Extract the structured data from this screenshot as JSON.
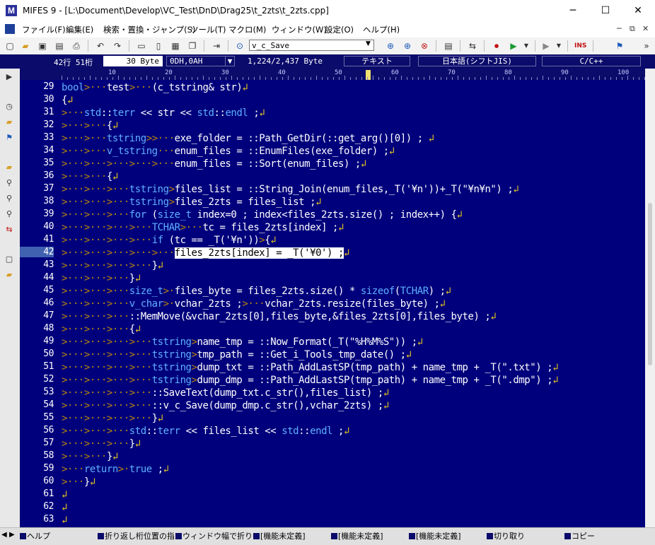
{
  "window": {
    "title": "MIFES 9 - [L:\\Document\\Develop\\VC_Test\\DnD\\Drag25\\t_2zts\\t_2zts.cpp]",
    "app_icon_letter": "M"
  },
  "menu": [
    "ファイル(F)",
    "編集(E)",
    "検索・置換・ジャンプ(S)",
    "ツール(T)",
    "マクロ(M)",
    "ウィンドウ(W)",
    "設定(O)",
    "ヘルプ(H)"
  ],
  "toolbar": {
    "search_value": "v_c_Save"
  },
  "status": {
    "position": "42行  51桁",
    "bytes": "30 Byte",
    "code": "0DH,0AH",
    "size": "1,224/2,437 Byte",
    "mode": "テキスト",
    "encoding": "日本語(シフトJIS)",
    "language": "C/C++"
  },
  "ruler": [
    "10",
    "20",
    "30",
    "40",
    "50",
    "60",
    "70",
    "80",
    "90",
    "100"
  ],
  "editor": {
    "current_line": "42",
    "lines": [
      {
        "n": "29",
        "t": "bool>···test>···(c_tstring& str)↲"
      },
      {
        "n": "30",
        "t": "{↲"
      },
      {
        "n": "31",
        "t": ">···std::terr << str << std::endl ;↲"
      },
      {
        "n": "32",
        "t": ">···>···{↲"
      },
      {
        "n": "33",
        "t": ">···>···tstring>>···exe_folder = ::Path_GetDir(::get_arg()[0]) ; ↲"
      },
      {
        "n": "34",
        "t": ">···>···v_tstring···enum_files = ::EnumFiles(exe_folder) ;↲"
      },
      {
        "n": "35",
        "t": ">···>···>···>···>···enum_files = ::Sort(enum_files) ;↲"
      },
      {
        "n": "36",
        "t": ">···>···{↲"
      },
      {
        "n": "37",
        "t": ">···>···>···tstring>files_list = ::String_Join(enum_files,_T('¥n'))+_T(\"¥n¥n\") ;↲"
      },
      {
        "n": "38",
        "t": ">···>···>···tstring>files_2zts = files_list ;↲"
      },
      {
        "n": "39",
        "t": ">···>···>···for (size_t index=0 ; index<files_2zts.size() ; index++) {↲"
      },
      {
        "n": "40",
        "t": ">···>···>···>···TCHAR>···tc = files_2zts[index] ;↲"
      },
      {
        "n": "41",
        "t": ">···>···>···>···if (tc == _T('¥n'))>{↲"
      },
      {
        "n": "42",
        "t": ">···>···>···>···>···files_2zts[index] = _T('¥0') ;↲"
      },
      {
        "n": "43",
        "t": ">···>···>···>···}↲"
      },
      {
        "n": "44",
        "t": ">···>···>···}↲"
      },
      {
        "n": "45",
        "t": ">···>···>···size_t>·files_byte = files_2zts.size() * sizeof(TCHAR) ;↲"
      },
      {
        "n": "46",
        "t": ">···>···>···v_char>·vchar_2zts ;>···vchar_2zts.resize(files_byte) ;↲"
      },
      {
        "n": "47",
        "t": ">···>···>···::MemMove(&vchar_2zts[0],files_byte,&files_2zts[0],files_byte) ;↲"
      },
      {
        "n": "48",
        "t": ">···>···>···{↲"
      },
      {
        "n": "49",
        "t": ">···>···>···>···tstring>name_tmp = ::Now_Format(_T(\"%H%M%S\")) ;↲"
      },
      {
        "n": "50",
        "t": ">···>···>···>···tstring>tmp_path = ::Get_i_Tools_tmp_date() ;↲"
      },
      {
        "n": "51",
        "t": ">···>···>···>···tstring>dump_txt = ::Path_AddLastSP(tmp_path) + name_tmp + _T(\".txt\") ;↲"
      },
      {
        "n": "52",
        "t": ">···>···>···>···tstring>dump_dmp = ::Path_AddLastSP(tmp_path) + name_tmp + _T(\".dmp\") ;↲"
      },
      {
        "n": "53",
        "t": ">···>···>···>···::SaveText(dump_txt.c_str(),files_list) ;↲"
      },
      {
        "n": "54",
        "t": ">···>···>···>···::v_c_Save(dump_dmp.c_str(),vchar_2zts) ;↲"
      },
      {
        "n": "55",
        "t": ">···>···>···>···}↲"
      },
      {
        "n": "56",
        "t": ">···>···>···std::terr << files_list << std::endl ;↲"
      },
      {
        "n": "57",
        "t": ">···>···>···}↲"
      },
      {
        "n": "58",
        "t": ">···>···}↲"
      },
      {
        "n": "59",
        "t": ">···return>·true ;↲"
      },
      {
        "n": "60",
        "t": ">···}↲"
      },
      {
        "n": "61",
        "t": "↲"
      },
      {
        "n": "62",
        "t": "↲"
      },
      {
        "n": "63",
        "t": "↲"
      }
    ]
  },
  "fkeys": [
    "ヘルプ",
    "折り返し桁位置の指",
    "ウィンドウ幅で折り返",
    "[機能未定義]",
    "[機能未定義]",
    "[機能未定義]",
    "切り取り",
    "コピー"
  ],
  "colors": {
    "editor_bg": "#00007c",
    "keyword": "#5fb0ff",
    "tab_marker": "#b8860b",
    "eol_marker": "#e0c020",
    "text": "#ffffff"
  }
}
